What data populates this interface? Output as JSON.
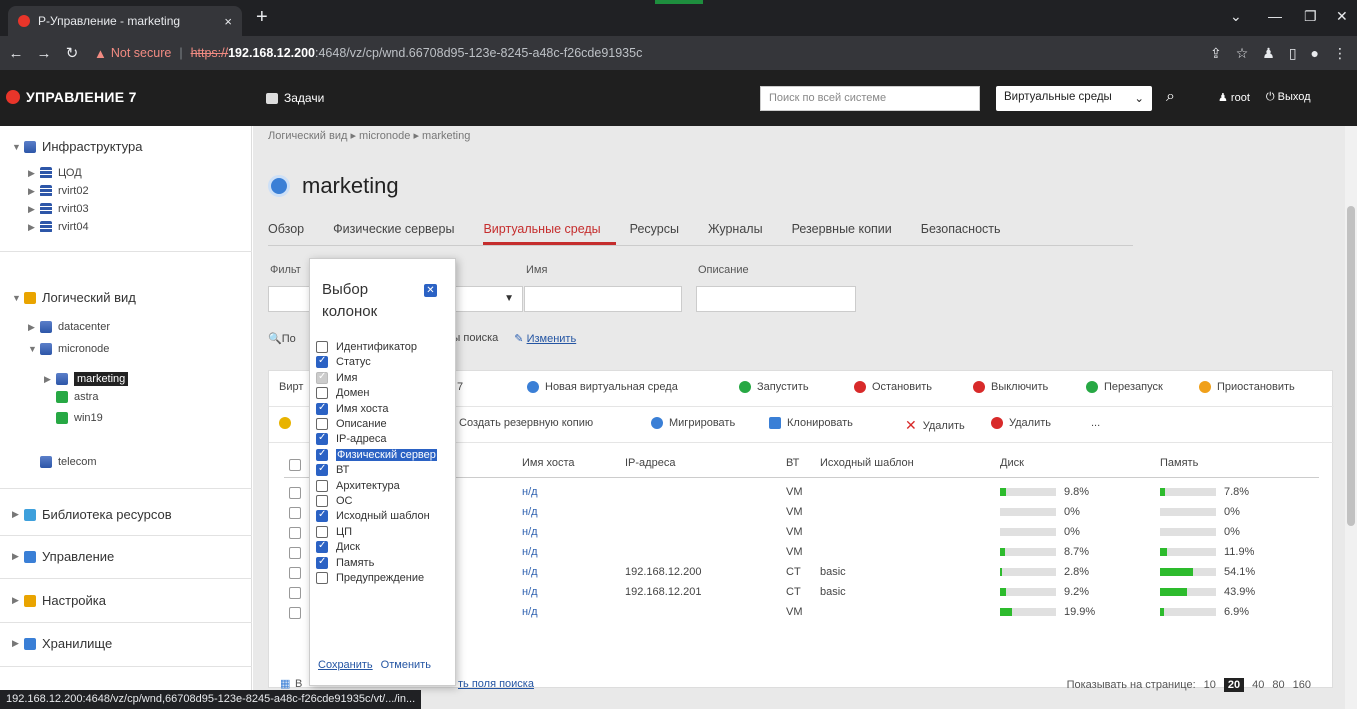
{
  "browser": {
    "tab_title": "Р-Управление - marketing",
    "tab_close": "×",
    "new_tab": "+",
    "not_secure": "Not secure",
    "url_scheme": "https://",
    "url_host": "192.168.12.200",
    "url_path": ":4648/vz/cp/wnd.66708d95-123e-8245-a48c-f26cde91935c",
    "status_url": "192.168.12.200:4648/vz/cp/wnd,66708d95-123e-8245-a48c-f26cde91935c/vt/.../in..."
  },
  "header": {
    "logo": "УПРАВЛЕНИЕ 7",
    "tasks": "Задачи",
    "search_placeholder": "Поиск по всей системе",
    "env_select": "Виртуальные среды",
    "user": "root",
    "logout": "Выход"
  },
  "sidebar": {
    "infra": "Инфраструктура",
    "dc": "ЦОД",
    "rvirt02": "rvirt02",
    "rvirt03": "rvirt03",
    "rvirt04": "rvirt04",
    "logical": "Логический вид",
    "datacenter": "datacenter",
    "micronode": "micronode",
    "marketing": "marketing",
    "astra": "astra",
    "win19": "win19",
    "telecom": "telecom",
    "library": "Библиотека ресурсов",
    "management": "Управление",
    "settings": "Настройка",
    "storage": "Хранилище"
  },
  "main": {
    "breadcrumb": "Логический вид ▸ micronode ▸ marketing",
    "title": "marketing",
    "tabs": [
      "Обзор",
      "Физические серверы",
      "Виртуальные среды",
      "Ресурсы",
      "Журналы",
      "Резервные копии",
      "Безопасность"
    ],
    "filter_label": "Фильт",
    "name_label": "Имя",
    "desc_label": "Описание",
    "search_prefix": "По",
    "results_text": "ьтаты поиска",
    "change_link": "Изменить",
    "toolbar1": {
      "virt_prefix": "Вирт",
      "count_suffix": "7",
      "new_env": "Новая виртуальная среда",
      "start": "Запустить",
      "stop": "Остановить",
      "poweroff": "Выключить",
      "restart": "Перезапуск",
      "suspend": "Приостановить"
    },
    "toolbar2": {
      "backup": "Создать резервную копию",
      "migrate": "Мигрировать",
      "clone": "Клонировать",
      "delete1": "Удалить",
      "delete2": "Удалить",
      "more": "..."
    },
    "columns": {
      "host": "Имя хоста",
      "ip": "IP-адреса",
      "vt": "ВТ",
      "template": "Исходный шаблон",
      "disk": "Диск",
      "memory": "Память"
    },
    "rows": [
      {
        "host": "н/д",
        "ip": "",
        "vt": "VM",
        "template": "",
        "disk": "9.8%",
        "disk_v": 9.8,
        "mem": "7.8%",
        "mem_v": 7.8
      },
      {
        "host": "н/д",
        "ip": "",
        "vt": "VM",
        "template": "",
        "disk": "0%",
        "disk_v": 0,
        "mem": "0%",
        "mem_v": 0
      },
      {
        "host": "н/д",
        "ip": "",
        "vt": "VM",
        "template": "",
        "disk": "0%",
        "disk_v": 0,
        "mem": "0%",
        "mem_v": 0
      },
      {
        "host": "н/д",
        "ip": "",
        "vt": "VM",
        "template": "",
        "disk": "8.7%",
        "disk_v": 8.7,
        "mem": "11.9%",
        "mem_v": 11.9
      },
      {
        "host": "н/д",
        "ip": "192.168.12.200",
        "vt": "CT",
        "template": "basic",
        "disk": "2.8%",
        "disk_v": 2.8,
        "mem": "54.1%",
        "mem_v": 54.1
      },
      {
        "host": "н/д",
        "ip": "192.168.12.201",
        "vt": "CT",
        "template": "basic",
        "disk": "9.2%",
        "disk_v": 9.2,
        "mem": "43.9%",
        "mem_v": 43.9
      },
      {
        "host": "н/д",
        "ip": "",
        "vt": "VM",
        "template": "",
        "disk": "19.9%",
        "disk_v": 19.9,
        "mem": "6.9%",
        "mem_v": 6.9
      }
    ],
    "footer_prefix": "В",
    "footer_link": "ть поля поиска",
    "per_page_label": "Показывать на странице:",
    "per_page": [
      "10",
      "20",
      "40",
      "80",
      "160"
    ],
    "per_page_current": "20"
  },
  "popup": {
    "title": "Выбор колонок",
    "close": "✕",
    "options": [
      {
        "label": "Идентификатор",
        "state": "off"
      },
      {
        "label": "Статус",
        "state": "on"
      },
      {
        "label": "Имя",
        "state": "disabled"
      },
      {
        "label": "Домен",
        "state": "off"
      },
      {
        "label": "Имя хоста",
        "state": "on"
      },
      {
        "label": "Описание",
        "state": "off"
      },
      {
        "label": "IP-адреса",
        "state": "on"
      },
      {
        "label": "Физический сервер",
        "state": "on"
      },
      {
        "label": "ВТ",
        "state": "on"
      },
      {
        "label": "Архитектура",
        "state": "off"
      },
      {
        "label": "ОС",
        "state": "off"
      },
      {
        "label": "Исходный шаблон",
        "state": "on"
      },
      {
        "label": "ЦП",
        "state": "off"
      },
      {
        "label": "Диск",
        "state": "on"
      },
      {
        "label": "Память",
        "state": "on"
      },
      {
        "label": "Предупреждение",
        "state": "off"
      }
    ],
    "save": "Сохранить",
    "cancel": "Отменить"
  }
}
